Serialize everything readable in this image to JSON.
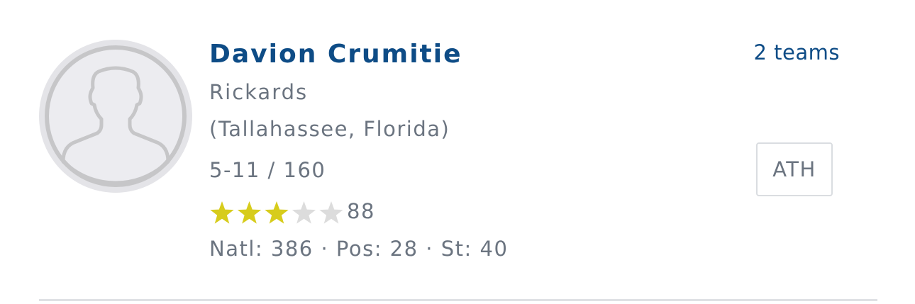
{
  "player": {
    "name": "Davion Crumitie",
    "school": "Rickards",
    "location": "(Tallahassee, Florida)",
    "height_weight": "5-11 / 160",
    "stars": 3,
    "max_stars": 5,
    "rating": "88",
    "ranks": "Natl: 386 · Pos: 28 · St: 40",
    "teams": "2 teams",
    "position": "ATH"
  },
  "colors": {
    "name": "#0e4c86",
    "text": "#6b7480",
    "star_filled": "#d7cc1c",
    "star_empty": "#dcdcdc",
    "avatar_bg": "#ececf0",
    "avatar_ring": "#c6c6c8"
  },
  "icons": {
    "avatar": "person-silhouette-icon",
    "star": "star-icon"
  }
}
